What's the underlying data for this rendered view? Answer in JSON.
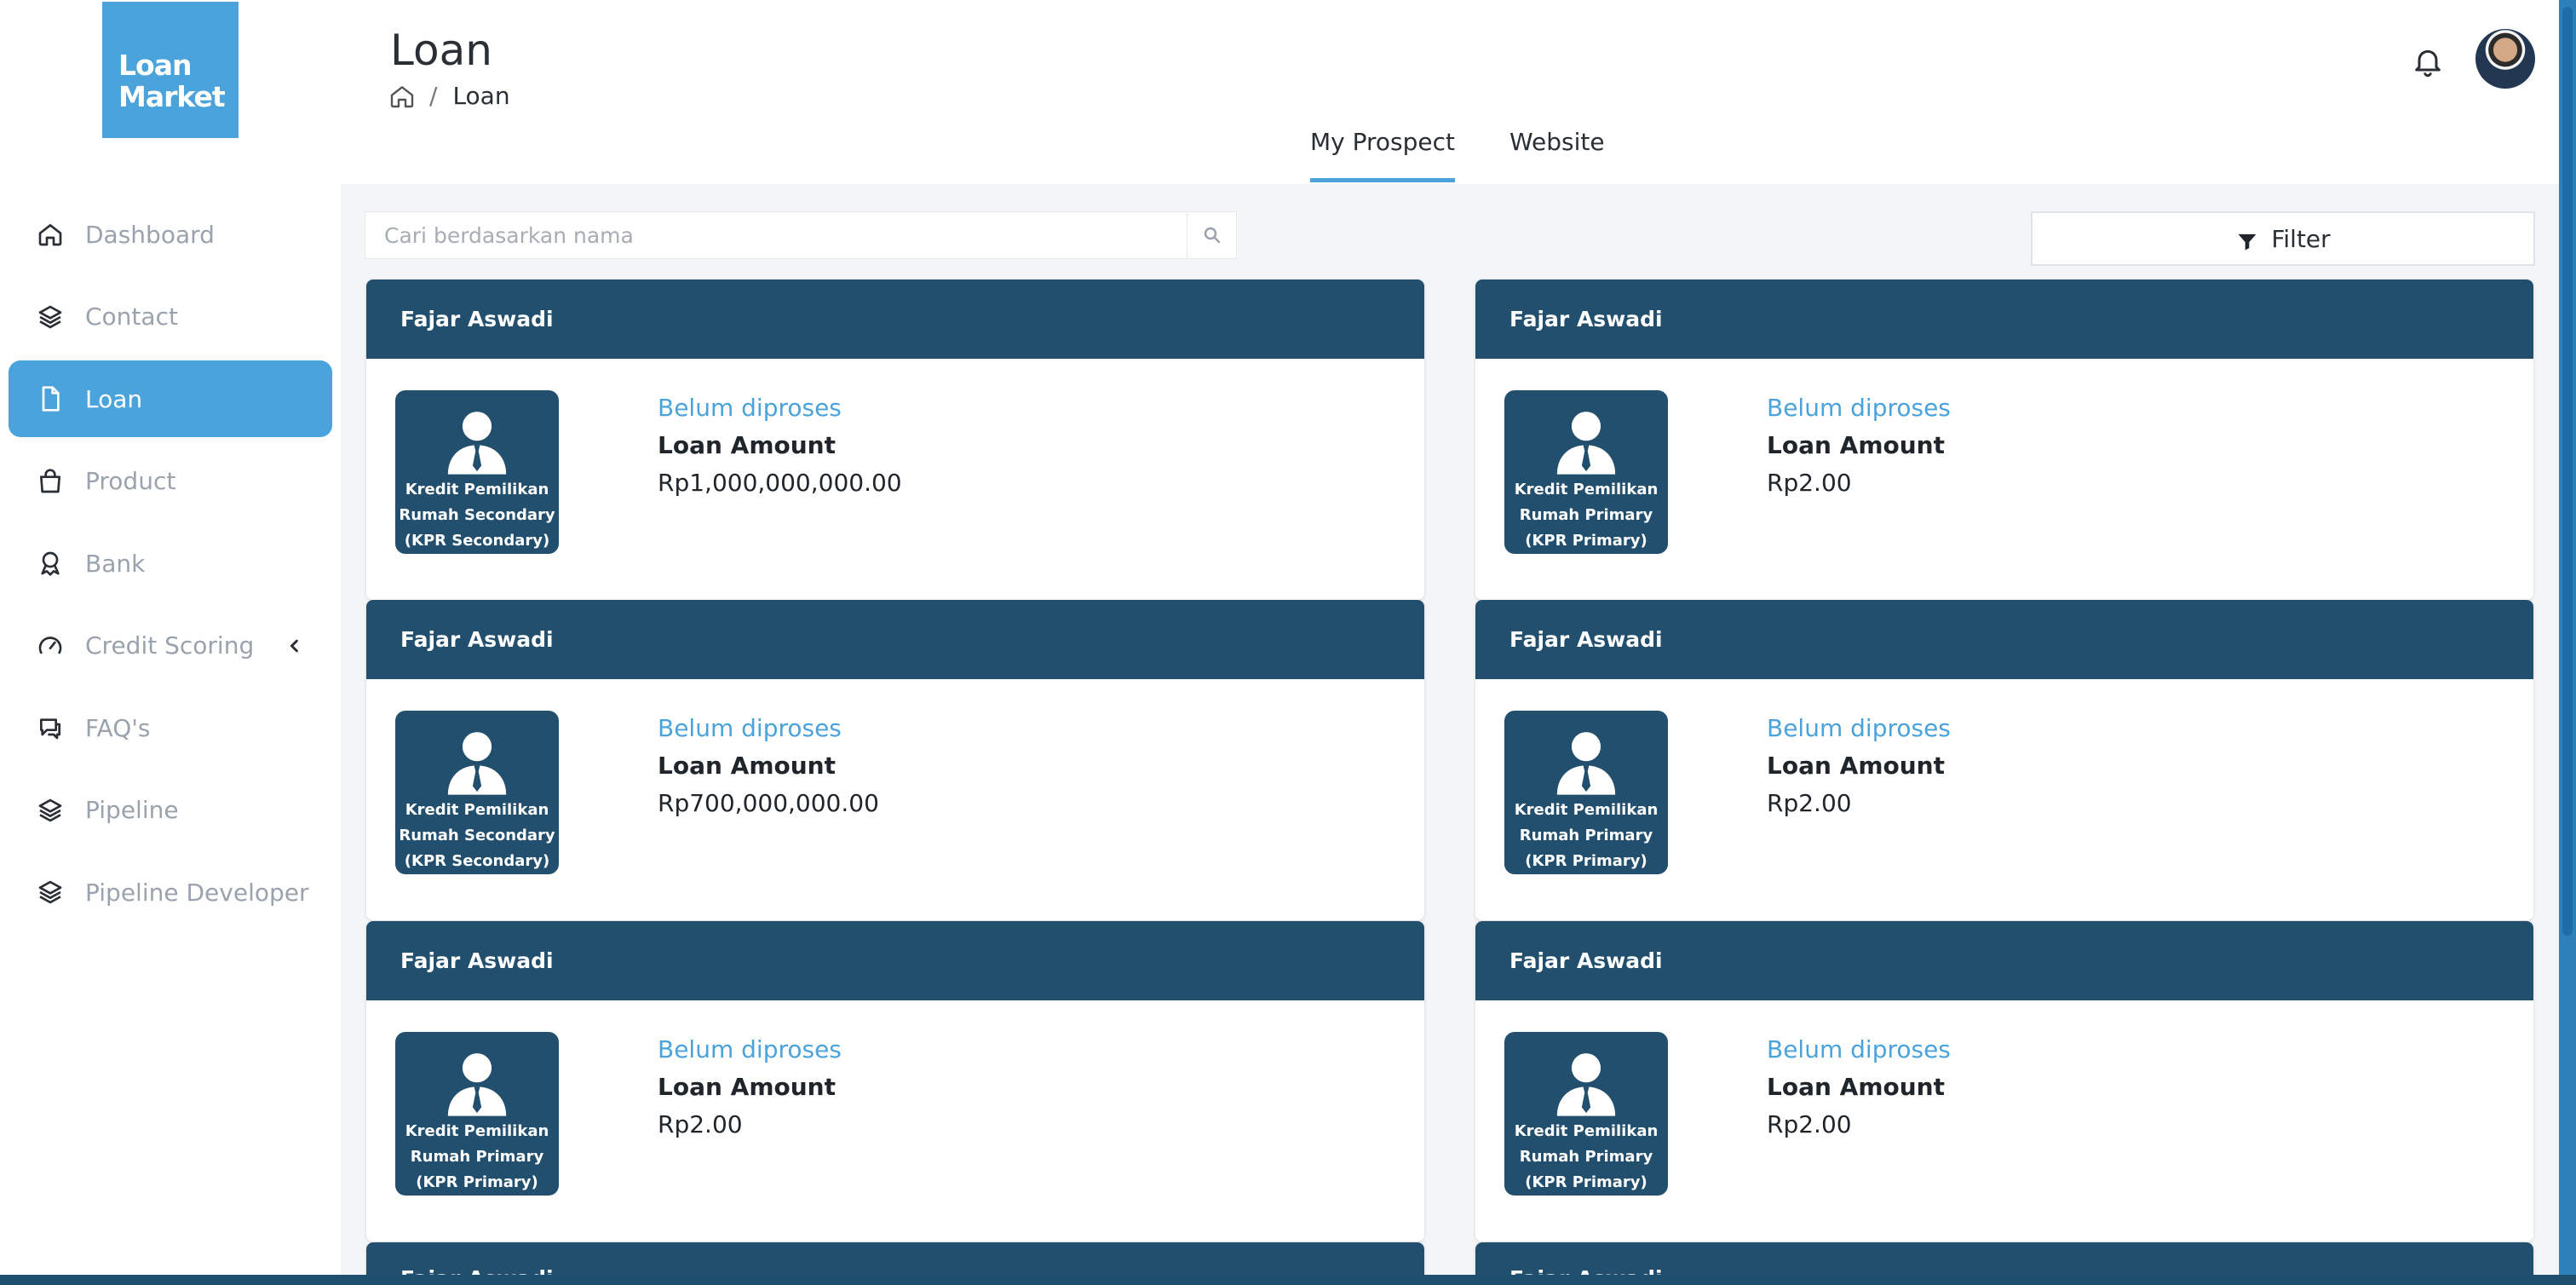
{
  "logo": {
    "line1": "Loan",
    "line2": "Market"
  },
  "sidebar": {
    "items": [
      {
        "label": "Dashboard",
        "icon": "home-icon",
        "active": false
      },
      {
        "label": "Contact",
        "icon": "layers-icon",
        "active": false
      },
      {
        "label": "Loan",
        "icon": "document-icon",
        "active": true
      },
      {
        "label": "Product",
        "icon": "bag-icon",
        "active": false
      },
      {
        "label": "Bank",
        "icon": "award-icon",
        "active": false
      },
      {
        "label": "Credit Scoring",
        "icon": "gauge-icon",
        "active": false,
        "has_chevron": true
      },
      {
        "label": "FAQ's",
        "icon": "chat-icon",
        "active": false
      },
      {
        "label": "Pipeline",
        "icon": "layers-icon",
        "active": false
      },
      {
        "label": "Pipeline Developer",
        "icon": "layers-icon",
        "active": false
      }
    ]
  },
  "header": {
    "title": "Loan",
    "breadcrumb": {
      "separator": "/",
      "current": "Loan"
    }
  },
  "tabs": [
    {
      "label": "My Prospect",
      "active": true
    },
    {
      "label": "Website",
      "active": false
    }
  ],
  "search": {
    "placeholder": "Cari berdasarkan nama",
    "value": ""
  },
  "filter": {
    "label": "Filter"
  },
  "cards": [
    {
      "name": "Fajar Aswadi",
      "product_line1": "Kredit Pemilikan",
      "product_line2": "Rumah Secondary",
      "product_line3": "(KPR Secondary)",
      "status": "Belum diproses",
      "amount_label": "Loan Amount",
      "amount": "Rp1,000,000,000.00"
    },
    {
      "name": "Fajar Aswadi",
      "product_line1": "Kredit Pemilikan",
      "product_line2": "Rumah Primary",
      "product_line3": "(KPR Primary)",
      "status": "Belum diproses",
      "amount_label": "Loan Amount",
      "amount": "Rp2.00"
    },
    {
      "name": "Fajar Aswadi",
      "product_line1": "Kredit Pemilikan",
      "product_line2": "Rumah Secondary",
      "product_line3": "(KPR Secondary)",
      "status": "Belum diproses",
      "amount_label": "Loan Amount",
      "amount": "Rp700,000,000.00"
    },
    {
      "name": "Fajar Aswadi",
      "product_line1": "Kredit Pemilikan",
      "product_line2": "Rumah Primary",
      "product_line3": "(KPR Primary)",
      "status": "Belum diproses",
      "amount_label": "Loan Amount",
      "amount": "Rp2.00"
    },
    {
      "name": "Fajar Aswadi",
      "product_line1": "Kredit Pemilikan",
      "product_line2": "Rumah Primary",
      "product_line3": "(KPR Primary)",
      "status": "Belum diproses",
      "amount_label": "Loan Amount",
      "amount": "Rp2.00"
    },
    {
      "name": "Fajar Aswadi",
      "product_line1": "Kredit Pemilikan",
      "product_line2": "Rumah Primary",
      "product_line3": "(KPR Primary)",
      "status": "Belum diproses",
      "amount_label": "Loan Amount",
      "amount": "Rp2.00"
    }
  ],
  "partial_cards": [
    {
      "name": "Fajar Aswadi"
    },
    {
      "name": "Fajar Aswadi"
    }
  ],
  "colors": {
    "accent": "#4ba3dc",
    "card_header": "#234f6e",
    "muted": "#9aa3ad"
  }
}
